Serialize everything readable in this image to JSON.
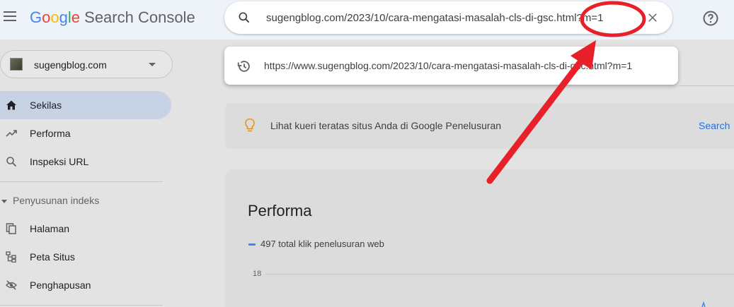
{
  "header": {
    "logo_letters": [
      "G",
      "o",
      "o",
      "g",
      "l",
      "e"
    ],
    "product": "Search Console",
    "search_value": "sugengblog.com/2023/10/cara-mengatasi-masalah-cls-di-gsc.html?m=1",
    "icons": {
      "menu": "hamburger-menu-icon",
      "search": "search-icon",
      "clear": "close-icon",
      "help": "help-icon"
    }
  },
  "suggestion": {
    "text": "https://www.sugengblog.com/2023/10/cara-mengatasi-masalah-cls-di-gsc.html?m=1",
    "icon": "history-icon"
  },
  "sidebar": {
    "property": "sugengblog.com",
    "items": [
      {
        "label": "Sekilas",
        "icon": "home-icon",
        "active": true
      },
      {
        "label": "Performa",
        "icon": "trending-up-icon",
        "active": false
      },
      {
        "label": "Inspeksi URL",
        "icon": "search-icon",
        "active": false
      }
    ],
    "section": "Penyusunan indeks",
    "section_items": [
      {
        "label": "Halaman",
        "icon": "pages-icon"
      },
      {
        "label": "Peta Situs",
        "icon": "sitemap-icon"
      },
      {
        "label": "Penghapusan",
        "icon": "visibility-off-icon"
      }
    ]
  },
  "main": {
    "tip_text": "Lihat kueri teratas situs Anda di Google Penelusuran",
    "tip_link": "Search",
    "performance": {
      "title": "Performa",
      "legend": "497 total klik penelusuran web",
      "y_tick": "18"
    }
  },
  "colors": {
    "header_bg": "#eef2f9",
    "accent": "#1a73e8",
    "active_nav": "#c7d2e4",
    "annotation_red": "#e8202a",
    "series": "#4285f4"
  }
}
